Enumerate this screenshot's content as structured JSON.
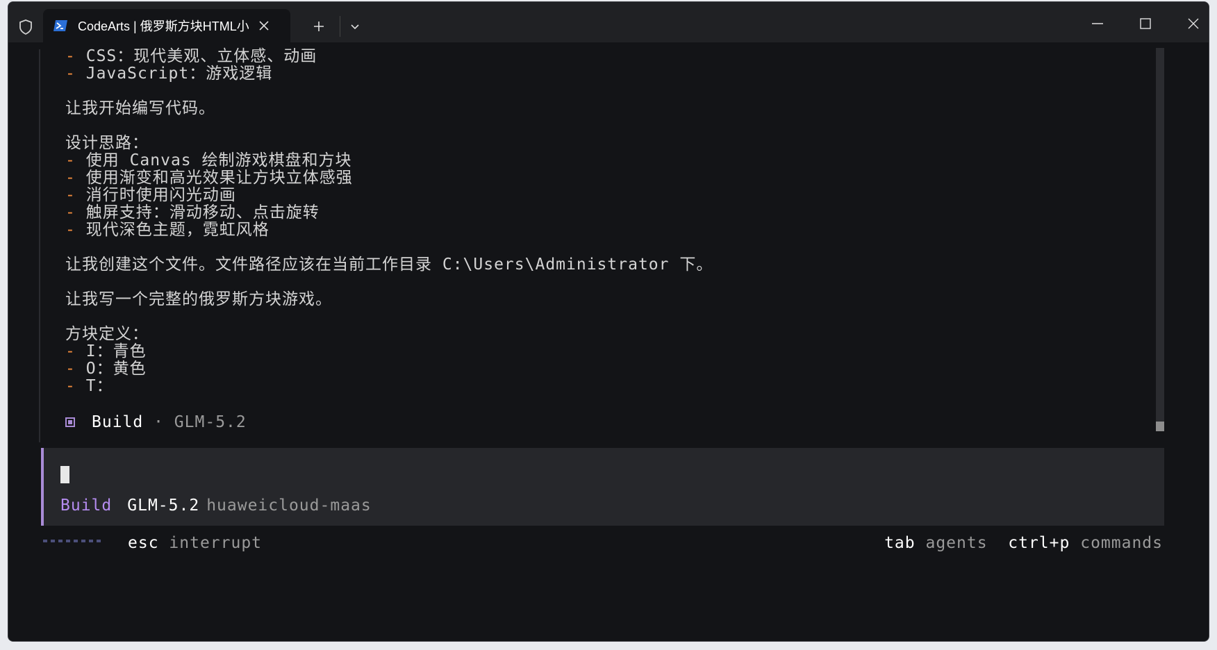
{
  "window": {
    "tab_title": "CodeArts | 俄罗斯方块HTML小",
    "icons": [
      "shield-icon",
      "powershell-icon",
      "close-icon",
      "plus-icon",
      "chevron-down-icon",
      "minimize-icon",
      "maximize-icon",
      "close-icon"
    ]
  },
  "terminal": {
    "lines": [
      {
        "dash": "-",
        "text": "CSS：现代美观、立体感、动画"
      },
      {
        "dash": "-",
        "text": "JavaScript：游戏逻辑"
      },
      {
        "dash": "",
        "text": ""
      },
      {
        "dash": "",
        "text": "让我开始编写代码。"
      },
      {
        "dash": "",
        "text": ""
      },
      {
        "dash": "",
        "text": "设计思路："
      },
      {
        "dash": "-",
        "text": "使用 Canvas 绘制游戏棋盘和方块"
      },
      {
        "dash": "-",
        "text": "使用渐变和高光效果让方块立体感强"
      },
      {
        "dash": "-",
        "text": "消行时使用闪光动画"
      },
      {
        "dash": "-",
        "text": "触屏支持：滑动移动、点击旋转"
      },
      {
        "dash": "-",
        "text": "现代深色主题，霓虹风格"
      },
      {
        "dash": "",
        "text": ""
      },
      {
        "dash": "",
        "text": "让我创建这个文件。文件路径应该在当前工作目录 C:\\Users\\Administrator 下。"
      },
      {
        "dash": "",
        "text": ""
      },
      {
        "dash": "",
        "text": "让我写一个完整的俄罗斯方块游戏。"
      },
      {
        "dash": "",
        "text": ""
      },
      {
        "dash": "",
        "text": "方块定义："
      },
      {
        "dash": "-",
        "text": "I：青色"
      },
      {
        "dash": "-",
        "text": "O：黄色"
      },
      {
        "dash": "-",
        "text": "T："
      }
    ],
    "build": {
      "label": "Build",
      "meta": "· GLM-5.2"
    }
  },
  "input": {
    "agent": "Build",
    "model": "GLM-5.2",
    "provider": "huaweicloud-maas"
  },
  "status": {
    "esc_key": "esc",
    "esc_desc": "interrupt",
    "tab_key": "tab",
    "tab_desc": "agents",
    "cmd_key": "ctrl+p",
    "cmd_desc": "commands"
  },
  "colors": {
    "accent_purple": "#a98bd6",
    "dash_orange": "#f08a3c",
    "background": "#131417"
  }
}
